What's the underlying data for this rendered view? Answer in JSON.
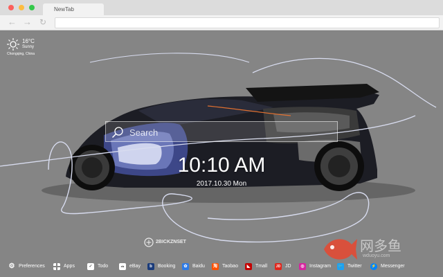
{
  "browser": {
    "tab_title": "NewTab"
  },
  "weather": {
    "temperature": "16°C",
    "condition": "Sunny",
    "location": "Chongqing,  China"
  },
  "search": {
    "placeholder": "Search"
  },
  "clock": {
    "time": "10:10 AM",
    "date": "2017.10.30 Mon"
  },
  "brand": {
    "text": "2BICKZNSET"
  },
  "watermark": {
    "text": "网多鱼",
    "subtext": "wduoyu.com"
  },
  "bottom_bar": {
    "items": [
      {
        "label": "Preferences",
        "icon": "gear-icon"
      },
      {
        "label": "Apps",
        "icon": "grid-icon"
      },
      {
        "label": "Todo",
        "icon": "checkbox-icon"
      },
      {
        "label": "eBay",
        "icon": "ebay-icon"
      },
      {
        "label": "Booking",
        "icon": "booking-icon"
      },
      {
        "label": "Baidu",
        "icon": "baidu-icon"
      },
      {
        "label": "Taobao",
        "icon": "taobao-icon"
      },
      {
        "label": "Tmall",
        "icon": "tmall-icon"
      },
      {
        "label": "JD",
        "icon": "jd-icon"
      },
      {
        "label": "Instagram",
        "icon": "instagram-icon"
      },
      {
        "label": "Twitter",
        "icon": "twitter-icon"
      },
      {
        "label": "Messenger",
        "icon": "messenger-icon"
      }
    ]
  },
  "colors": {
    "background": "#858585",
    "booking": "#1a3b7a",
    "baidu": "#2e7be6",
    "taobao": "#ff5000",
    "tmall": "#c40000",
    "jd": "#e1251b",
    "instagram": "#d6249f",
    "twitter": "#1da1f2",
    "messenger": "#0084ff"
  }
}
